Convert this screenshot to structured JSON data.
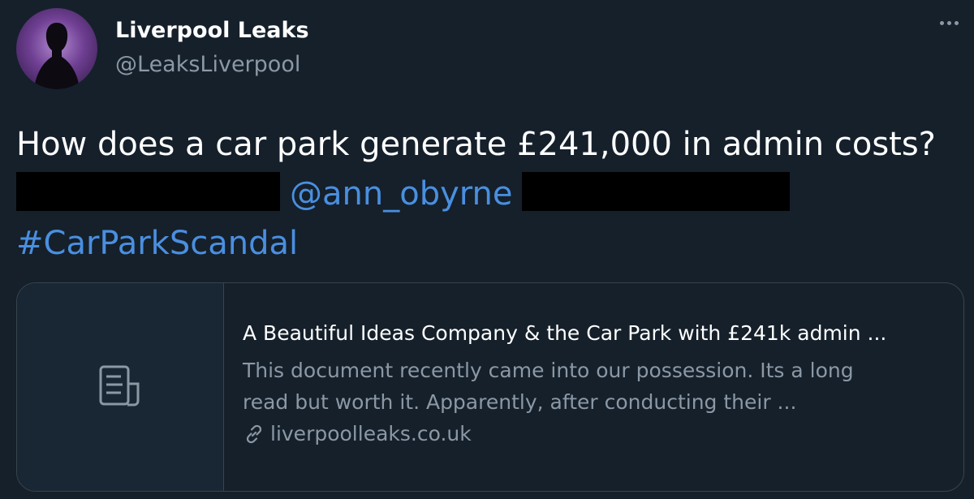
{
  "author": {
    "display_name": "Liverpool Leaks",
    "handle": "@LeaksLiverpool",
    "avatar_icon": "silhouette-avatar"
  },
  "more_icon": "more-horizontal-icon",
  "tweet": {
    "line1": "How does a car park generate £241,000 in admin costs?",
    "mention": "@ann_obyrne",
    "hashtag": "#CarParkScandal"
  },
  "card": {
    "thumb_icon": "document-icon",
    "title": "A Beautiful Ideas Company & the Car Park with £241k admin ...",
    "description_line1": "This document recently came into our possession.  Its a long",
    "description_line2": "read but worth it.  Apparently, after conducting their ...",
    "domain_icon": "link-icon",
    "domain": "liverpoolleaks.co.uk"
  },
  "colors": {
    "background": "#15202b",
    "link": "#4a8fe0",
    "secondary_text": "#8b98a5",
    "border": "#38444d"
  }
}
